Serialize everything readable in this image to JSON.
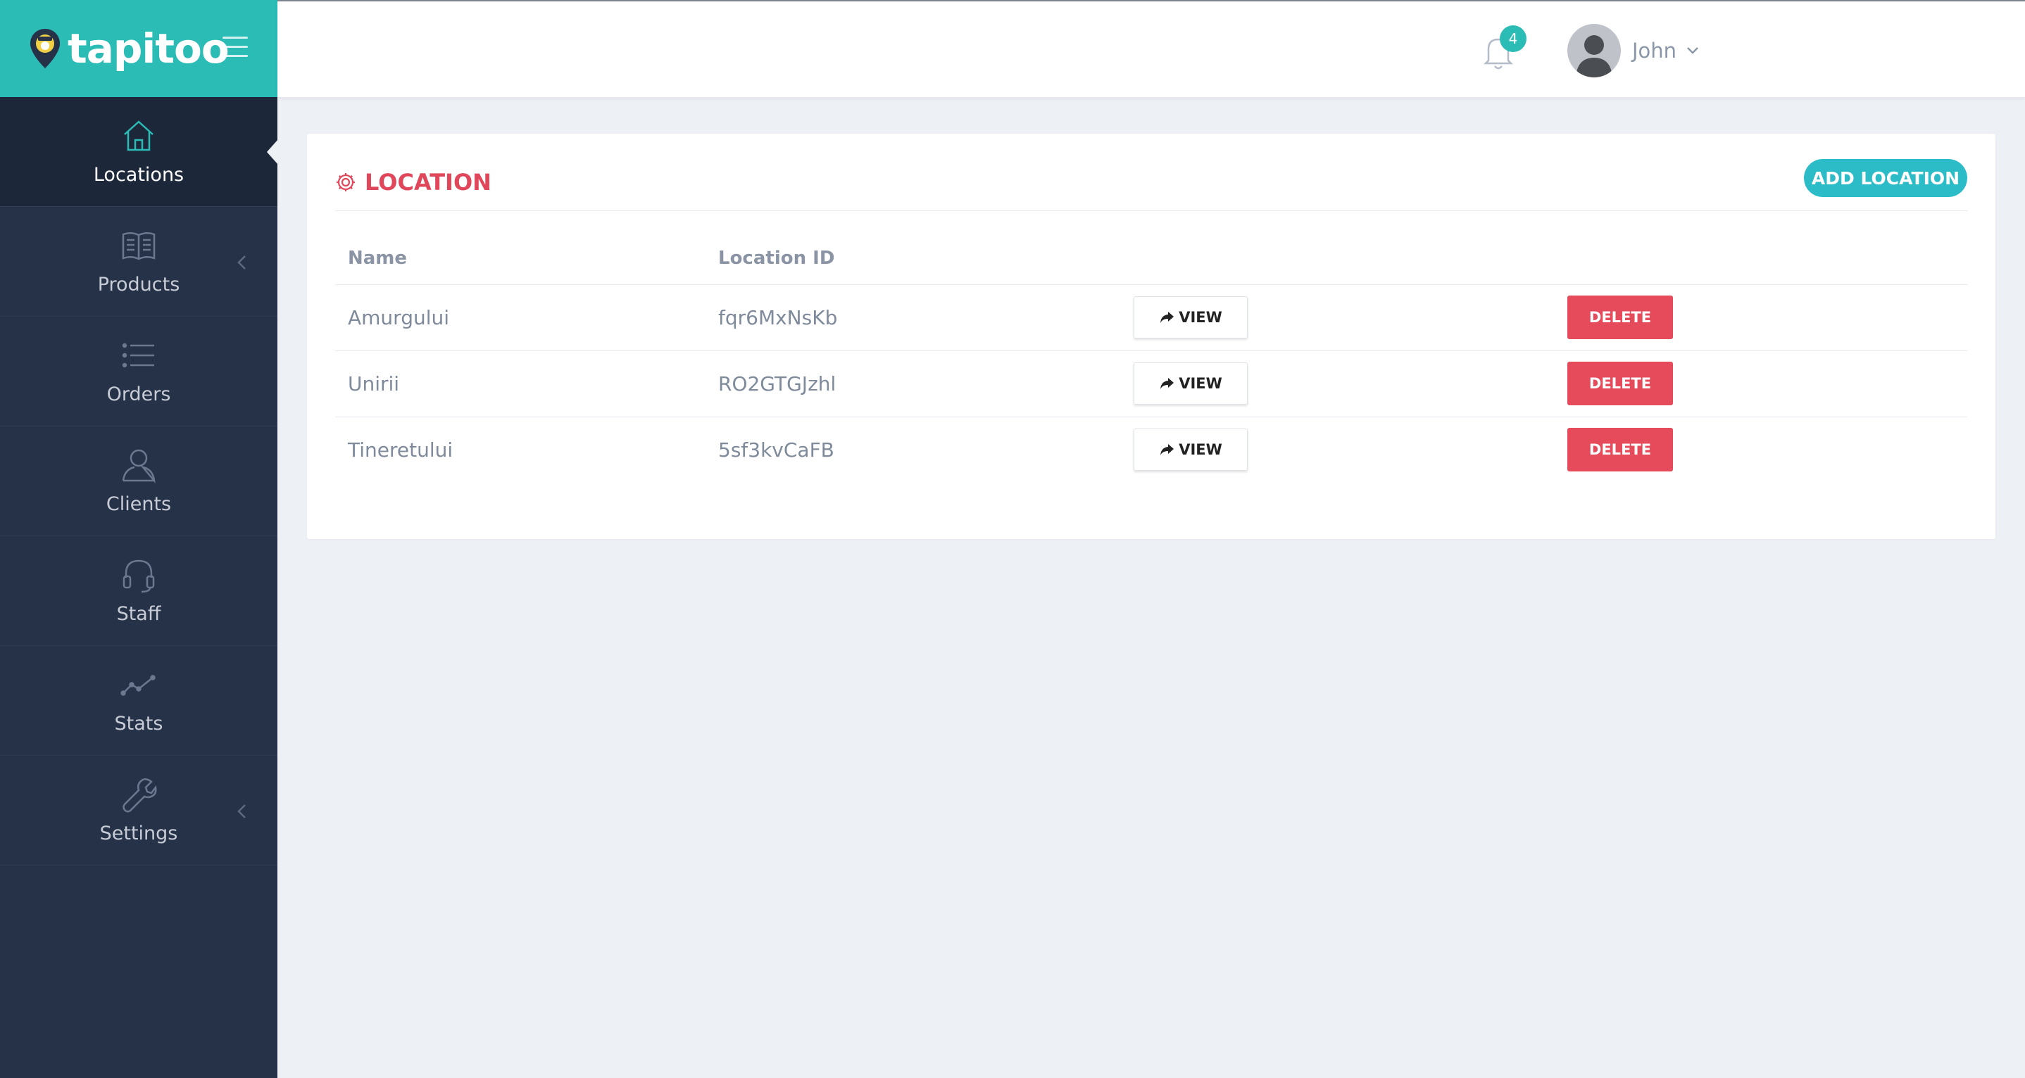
{
  "brand": {
    "name": "tapitoo"
  },
  "sidebar": {
    "items": [
      {
        "label": "Locations",
        "icon": "home-icon",
        "active": true
      },
      {
        "label": "Products",
        "icon": "book-icon",
        "has_submenu": true
      },
      {
        "label": "Orders",
        "icon": "list-icon"
      },
      {
        "label": "Clients",
        "icon": "user-icon"
      },
      {
        "label": "Staff",
        "icon": "headset-icon"
      },
      {
        "label": "Stats",
        "icon": "chart-line-icon"
      },
      {
        "label": "Settings",
        "icon": "wrench-icon",
        "has_submenu": true
      }
    ]
  },
  "header": {
    "notifications_count": "4",
    "user_name": "John"
  },
  "main": {
    "title": "LOCATION",
    "add_button": "ADD LOCATION",
    "columns": [
      "Name",
      "Location ID"
    ],
    "rows": [
      {
        "name": "Amurgului",
        "id": "fqr6MxNsKb",
        "view": "VIEW",
        "delete": "DELETE"
      },
      {
        "name": "Unirii",
        "id": "RO2GTGJzhl",
        "view": "VIEW",
        "delete": "DELETE"
      },
      {
        "name": "Tineretului",
        "id": "5sf3kvCaFB",
        "view": "VIEW",
        "delete": "DELETE"
      }
    ]
  },
  "colors": {
    "brand_teal": "#2bbcb6",
    "sidebar_bg": "#263248",
    "accent_red": "#e0475a",
    "delete_red": "#e64b5c"
  }
}
